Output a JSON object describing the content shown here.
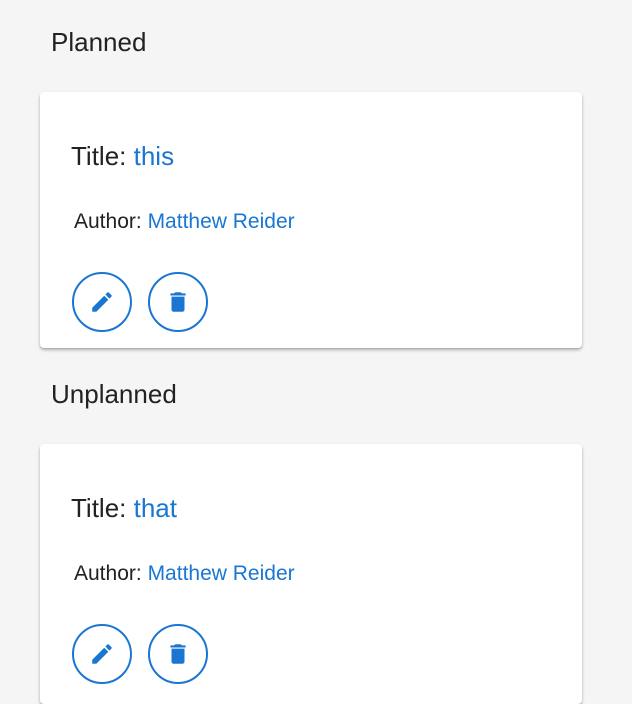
{
  "sections": [
    {
      "heading": "Planned",
      "card": {
        "title_label": "Title:",
        "title_value": "this",
        "author_label": "Author:",
        "author_value": "Matthew Reider",
        "actions": [
          {
            "name": "edit",
            "icon": "pencil-icon"
          },
          {
            "name": "delete",
            "icon": "trash-icon"
          }
        ]
      }
    },
    {
      "heading": "Unplanned",
      "card": {
        "title_label": "Title:",
        "title_value": "that",
        "author_label": "Author:",
        "author_value": "Matthew Reider",
        "actions": [
          {
            "name": "edit",
            "icon": "pencil-icon"
          },
          {
            "name": "delete",
            "icon": "trash-icon"
          }
        ]
      }
    }
  ],
  "colors": {
    "accent": "#1976d2",
    "background": "#f5f5f5",
    "card": "#ffffff",
    "text": "#222222"
  }
}
